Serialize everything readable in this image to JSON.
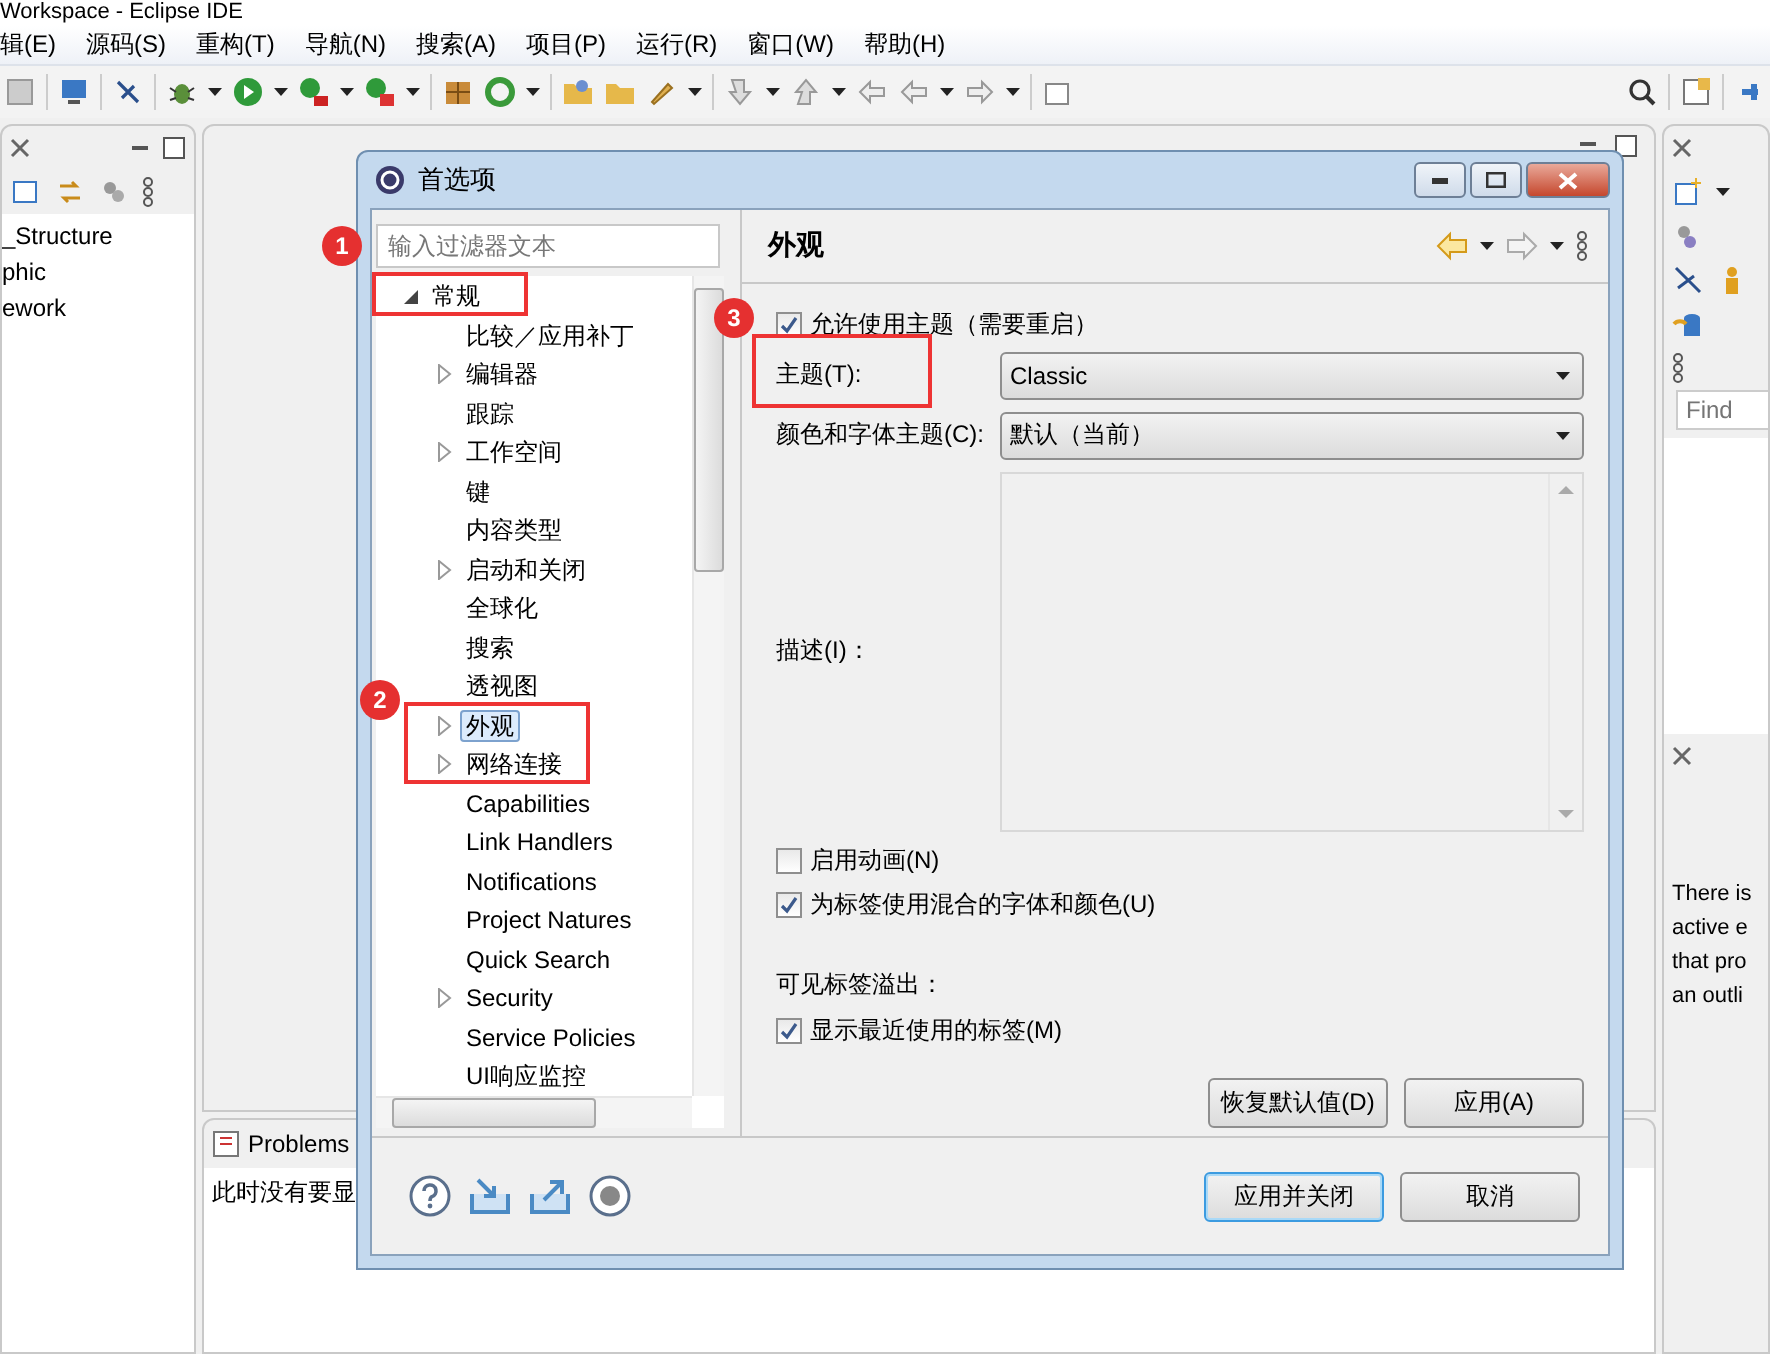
{
  "window": {
    "title": "Workspace - Eclipse IDE"
  },
  "menu": [
    "辑(E)",
    "源码(S)",
    "重构(T)",
    "导航(N)",
    "搜索(A)",
    "项目(P)",
    "运行(R)",
    "窗口(W)",
    "帮助(H)"
  ],
  "left_view": {
    "items": [
      "_Structure",
      "phic",
      "ework"
    ]
  },
  "bottom_view": {
    "tab": "Problems",
    "message": "此时没有要显"
  },
  "right_view": {
    "find_placeholder": "Find",
    "message_lines": [
      "There is",
      "active e",
      "that pro",
      "an outli"
    ]
  },
  "dialog": {
    "title": "首选项",
    "filter_placeholder": "输入过滤器文本",
    "tree": [
      {
        "label": "常规",
        "expanded": true,
        "selected": false,
        "children": [
          {
            "label": "比较／应用补丁",
            "selected": false
          },
          {
            "label": "编辑器",
            "expanded": false,
            "selected": false
          },
          {
            "label": "跟踪",
            "selected": false
          },
          {
            "label": "工作空间",
            "expanded": false,
            "selected": false
          },
          {
            "label": "键",
            "selected": false
          },
          {
            "label": "内容类型",
            "selected": false
          },
          {
            "label": "启动和关闭",
            "expanded": false,
            "selected": false
          },
          {
            "label": "全球化",
            "selected": false
          },
          {
            "label": "搜索",
            "selected": false
          },
          {
            "label": "透视图",
            "selected": false
          },
          {
            "label": "外观",
            "expanded": false,
            "selected": true
          },
          {
            "label": "网络连接",
            "expanded": false,
            "selected": false
          },
          {
            "label": "Capabilities",
            "selected": false
          },
          {
            "label": "Link Handlers",
            "selected": false
          },
          {
            "label": "Notifications",
            "selected": false
          },
          {
            "label": "Project Natures",
            "selected": false
          },
          {
            "label": "Quick Search",
            "selected": false
          },
          {
            "label": "Security",
            "expanded": false,
            "selected": false
          },
          {
            "label": "Service Policies",
            "selected": false
          },
          {
            "label": "UI响应监控",
            "selected": false
          }
        ]
      }
    ],
    "page": {
      "title": "外观",
      "enable_theming": {
        "label": "允许使用主题（需要重启）",
        "checked": true
      },
      "theme": {
        "label": "主题(T):",
        "value": "Classic"
      },
      "color_theme": {
        "label": "颜色和字体主题(C):",
        "value": "默认（当前）"
      },
      "description": {
        "label": "描述(I)："
      },
      "options": [
        {
          "label": "启用动画(N)",
          "checked": false
        },
        {
          "label": "为标签使用混合的字体和颜色(U)",
          "checked": true
        }
      ],
      "overflow": {
        "label": "可见标签溢出：",
        "options": [
          {
            "label": "显示最近使用的标签(M)",
            "checked": true
          }
        ]
      },
      "buttons": [
        "恢复默认值(D)",
        "应用(A)"
      ]
    },
    "buttons": [
      "应用并关闭",
      "取消"
    ]
  },
  "annotations": [
    {
      "label": "1"
    },
    {
      "label": "2"
    },
    {
      "label": "3"
    }
  ]
}
